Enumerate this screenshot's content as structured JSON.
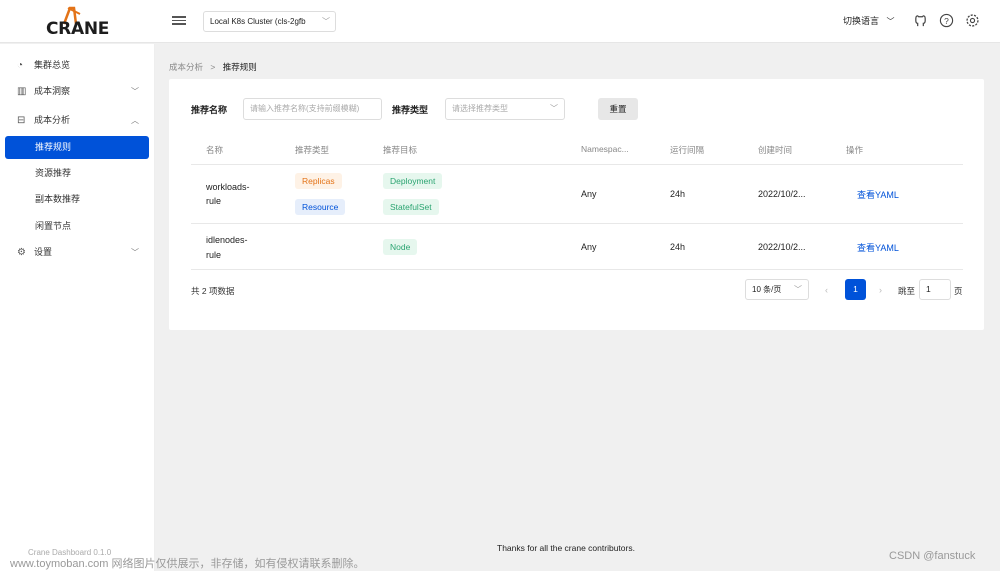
{
  "header": {
    "logo_text": "CRANE",
    "cluster": "Local K8s Cluster (cls-2gfb",
    "language_switch": "切换语言",
    "icons": [
      "github-icon",
      "help-icon",
      "settings-icon"
    ]
  },
  "sidebar": {
    "items": [
      {
        "icon": "dashboard-icon",
        "label": "集群总览"
      },
      {
        "icon": "chart-icon",
        "label": "成本洞察"
      },
      {
        "icon": "calculator-icon",
        "label": "成本分析"
      },
      {
        "label": "推荐规则"
      },
      {
        "label": "资源推荐"
      },
      {
        "label": "副本数推荐"
      },
      {
        "label": "闲置节点"
      },
      {
        "icon": "gear-icon",
        "label": "设置"
      }
    ],
    "version": "Crane Dashboard 0.1.0"
  },
  "breadcrumb": {
    "parent": "成本分析",
    "current": "推荐规则"
  },
  "filters": {
    "name_label": "推荐名称",
    "name_placeholder": "请输入推荐名称(支持前缀模糊)",
    "type_label": "推荐类型",
    "type_placeholder": "请选择推荐类型",
    "reset": "重置"
  },
  "table": {
    "headers": [
      "名称",
      "推荐类型",
      "推荐目标",
      "Namespac...",
      "运行间隔",
      "创建时间",
      "操作"
    ],
    "rows": [
      {
        "name_line1": "workloads-",
        "name_line2": "rule",
        "types": [
          "Replicas",
          "Resource"
        ],
        "targets": [
          "Deployment",
          "StatefulSet"
        ],
        "namespace": "Any",
        "interval": "24h",
        "created": "2022/10/2...",
        "action": "查看YAML"
      },
      {
        "name_line1": "idlenodes-",
        "name_line2": "rule",
        "types": [],
        "targets": [
          "Node"
        ],
        "namespace": "Any",
        "interval": "24h",
        "created": "2022/10/2...",
        "action": "查看YAML"
      }
    ]
  },
  "pagination": {
    "total": "共 2 项数据",
    "page_size": "10 条/页",
    "current_page": "1",
    "jump_label": "跳至",
    "jump_value": "1",
    "page_unit": "页"
  },
  "footer": "Thanks for all the crane contributors.",
  "watermark_left": "www.toymoban.com 网络图片仅供展示，非存储，如有侵权请联系删除。",
  "watermark_right": "CSDN @fanstuck",
  "colors": {
    "primary": "#0052d9",
    "orange_tag": "#e37318",
    "green_tag": "#2ba471"
  }
}
